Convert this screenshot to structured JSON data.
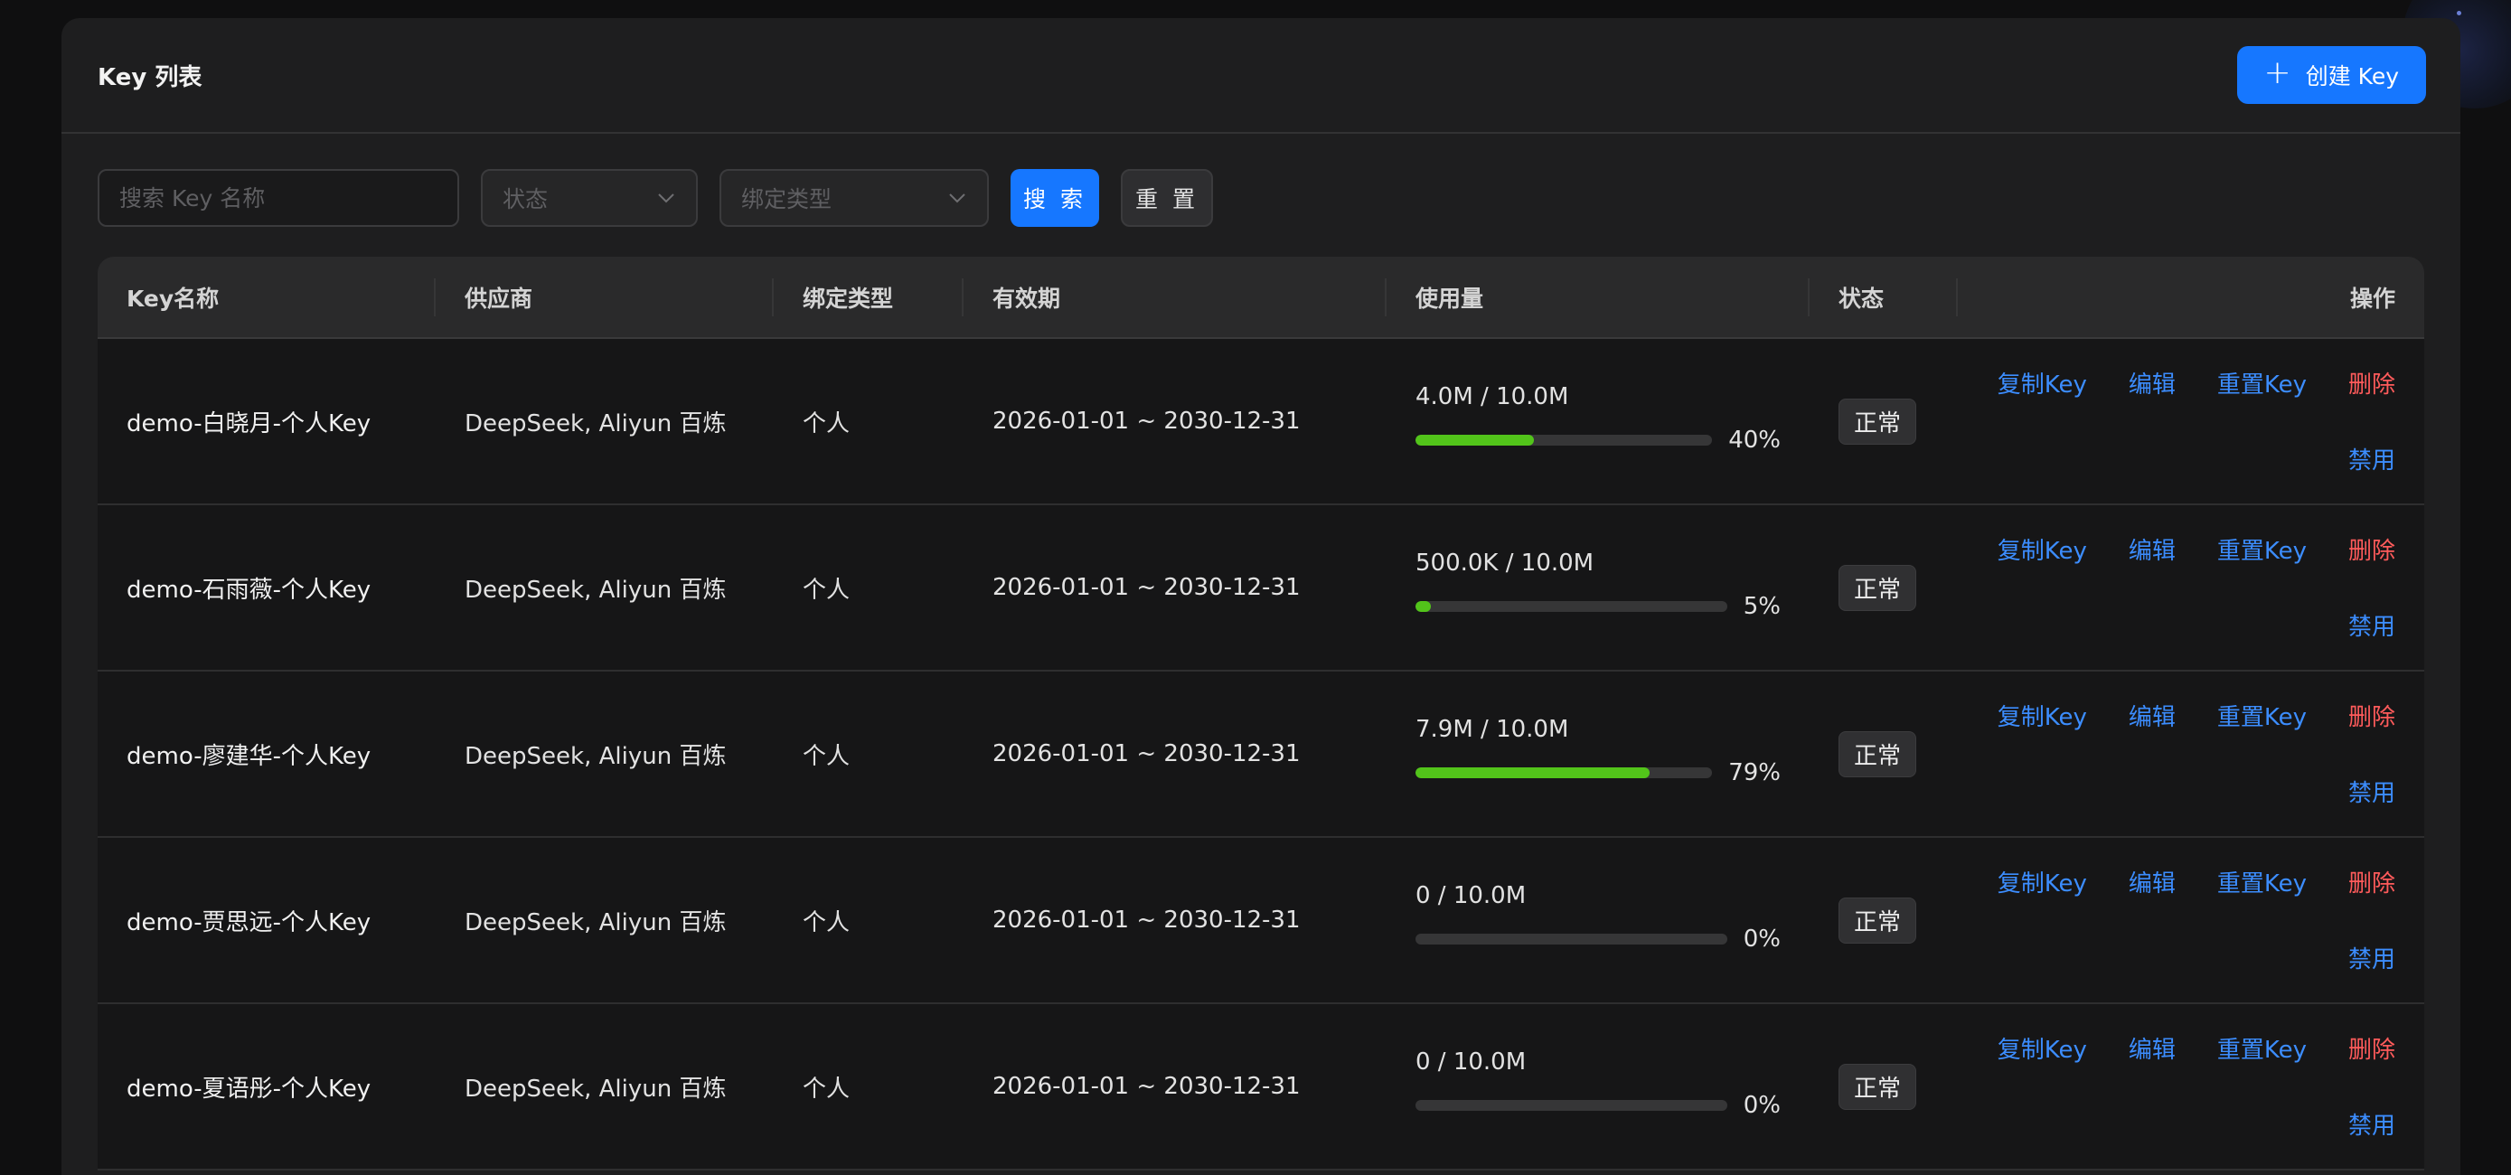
{
  "header": {
    "title": "Key 列表",
    "create_button": "创建 Key"
  },
  "filters": {
    "search_placeholder": "搜索 Key 名称",
    "status_placeholder": "状态",
    "bind_type_placeholder": "绑定类型",
    "search_button": "搜 索",
    "reset_button": "重 置"
  },
  "table": {
    "columns": [
      "Key名称",
      "供应商",
      "绑定类型",
      "有效期",
      "使用量",
      "状态",
      "操作"
    ],
    "actions": {
      "copy": "复制Key",
      "edit": "编辑",
      "reset": "重置Key",
      "delete": "删除",
      "disable": "禁用"
    },
    "rows": [
      {
        "name": "demo-白晓月-个人Key",
        "provider": "DeepSeek, Aliyun 百炼",
        "bind_type": "个人",
        "validity": "2026-01-01 ~ 2030-12-31",
        "usage": "4.0M / 10.0M",
        "percent": 40,
        "percent_label": "40%",
        "status": "正常"
      },
      {
        "name": "demo-石雨薇-个人Key",
        "provider": "DeepSeek, Aliyun 百炼",
        "bind_type": "个人",
        "validity": "2026-01-01 ~ 2030-12-31",
        "usage": "500.0K / 10.0M",
        "percent": 5,
        "percent_label": "5%",
        "status": "正常"
      },
      {
        "name": "demo-廖建华-个人Key",
        "provider": "DeepSeek, Aliyun 百炼",
        "bind_type": "个人",
        "validity": "2026-01-01 ~ 2030-12-31",
        "usage": "7.9M / 10.0M",
        "percent": 79,
        "percent_label": "79%",
        "status": "正常"
      },
      {
        "name": "demo-贾思远-个人Key",
        "provider": "DeepSeek, Aliyun 百炼",
        "bind_type": "个人",
        "validity": "2026-01-01 ~ 2030-12-31",
        "usage": "0 / 10.0M",
        "percent": 0,
        "percent_label": "0%",
        "status": "正常"
      },
      {
        "name": "demo-夏语彤-个人Key",
        "provider": "DeepSeek, Aliyun 百炼",
        "bind_type": "个人",
        "validity": "2026-01-01 ~ 2030-12-31",
        "usage": "0 / 10.0M",
        "percent": 0,
        "percent_label": "0%",
        "status": "正常"
      }
    ]
  },
  "colors": {
    "primary": "#1677ff",
    "success_bar": "#52c41a",
    "danger": "#ff5b5b",
    "link": "#3c8dff"
  }
}
